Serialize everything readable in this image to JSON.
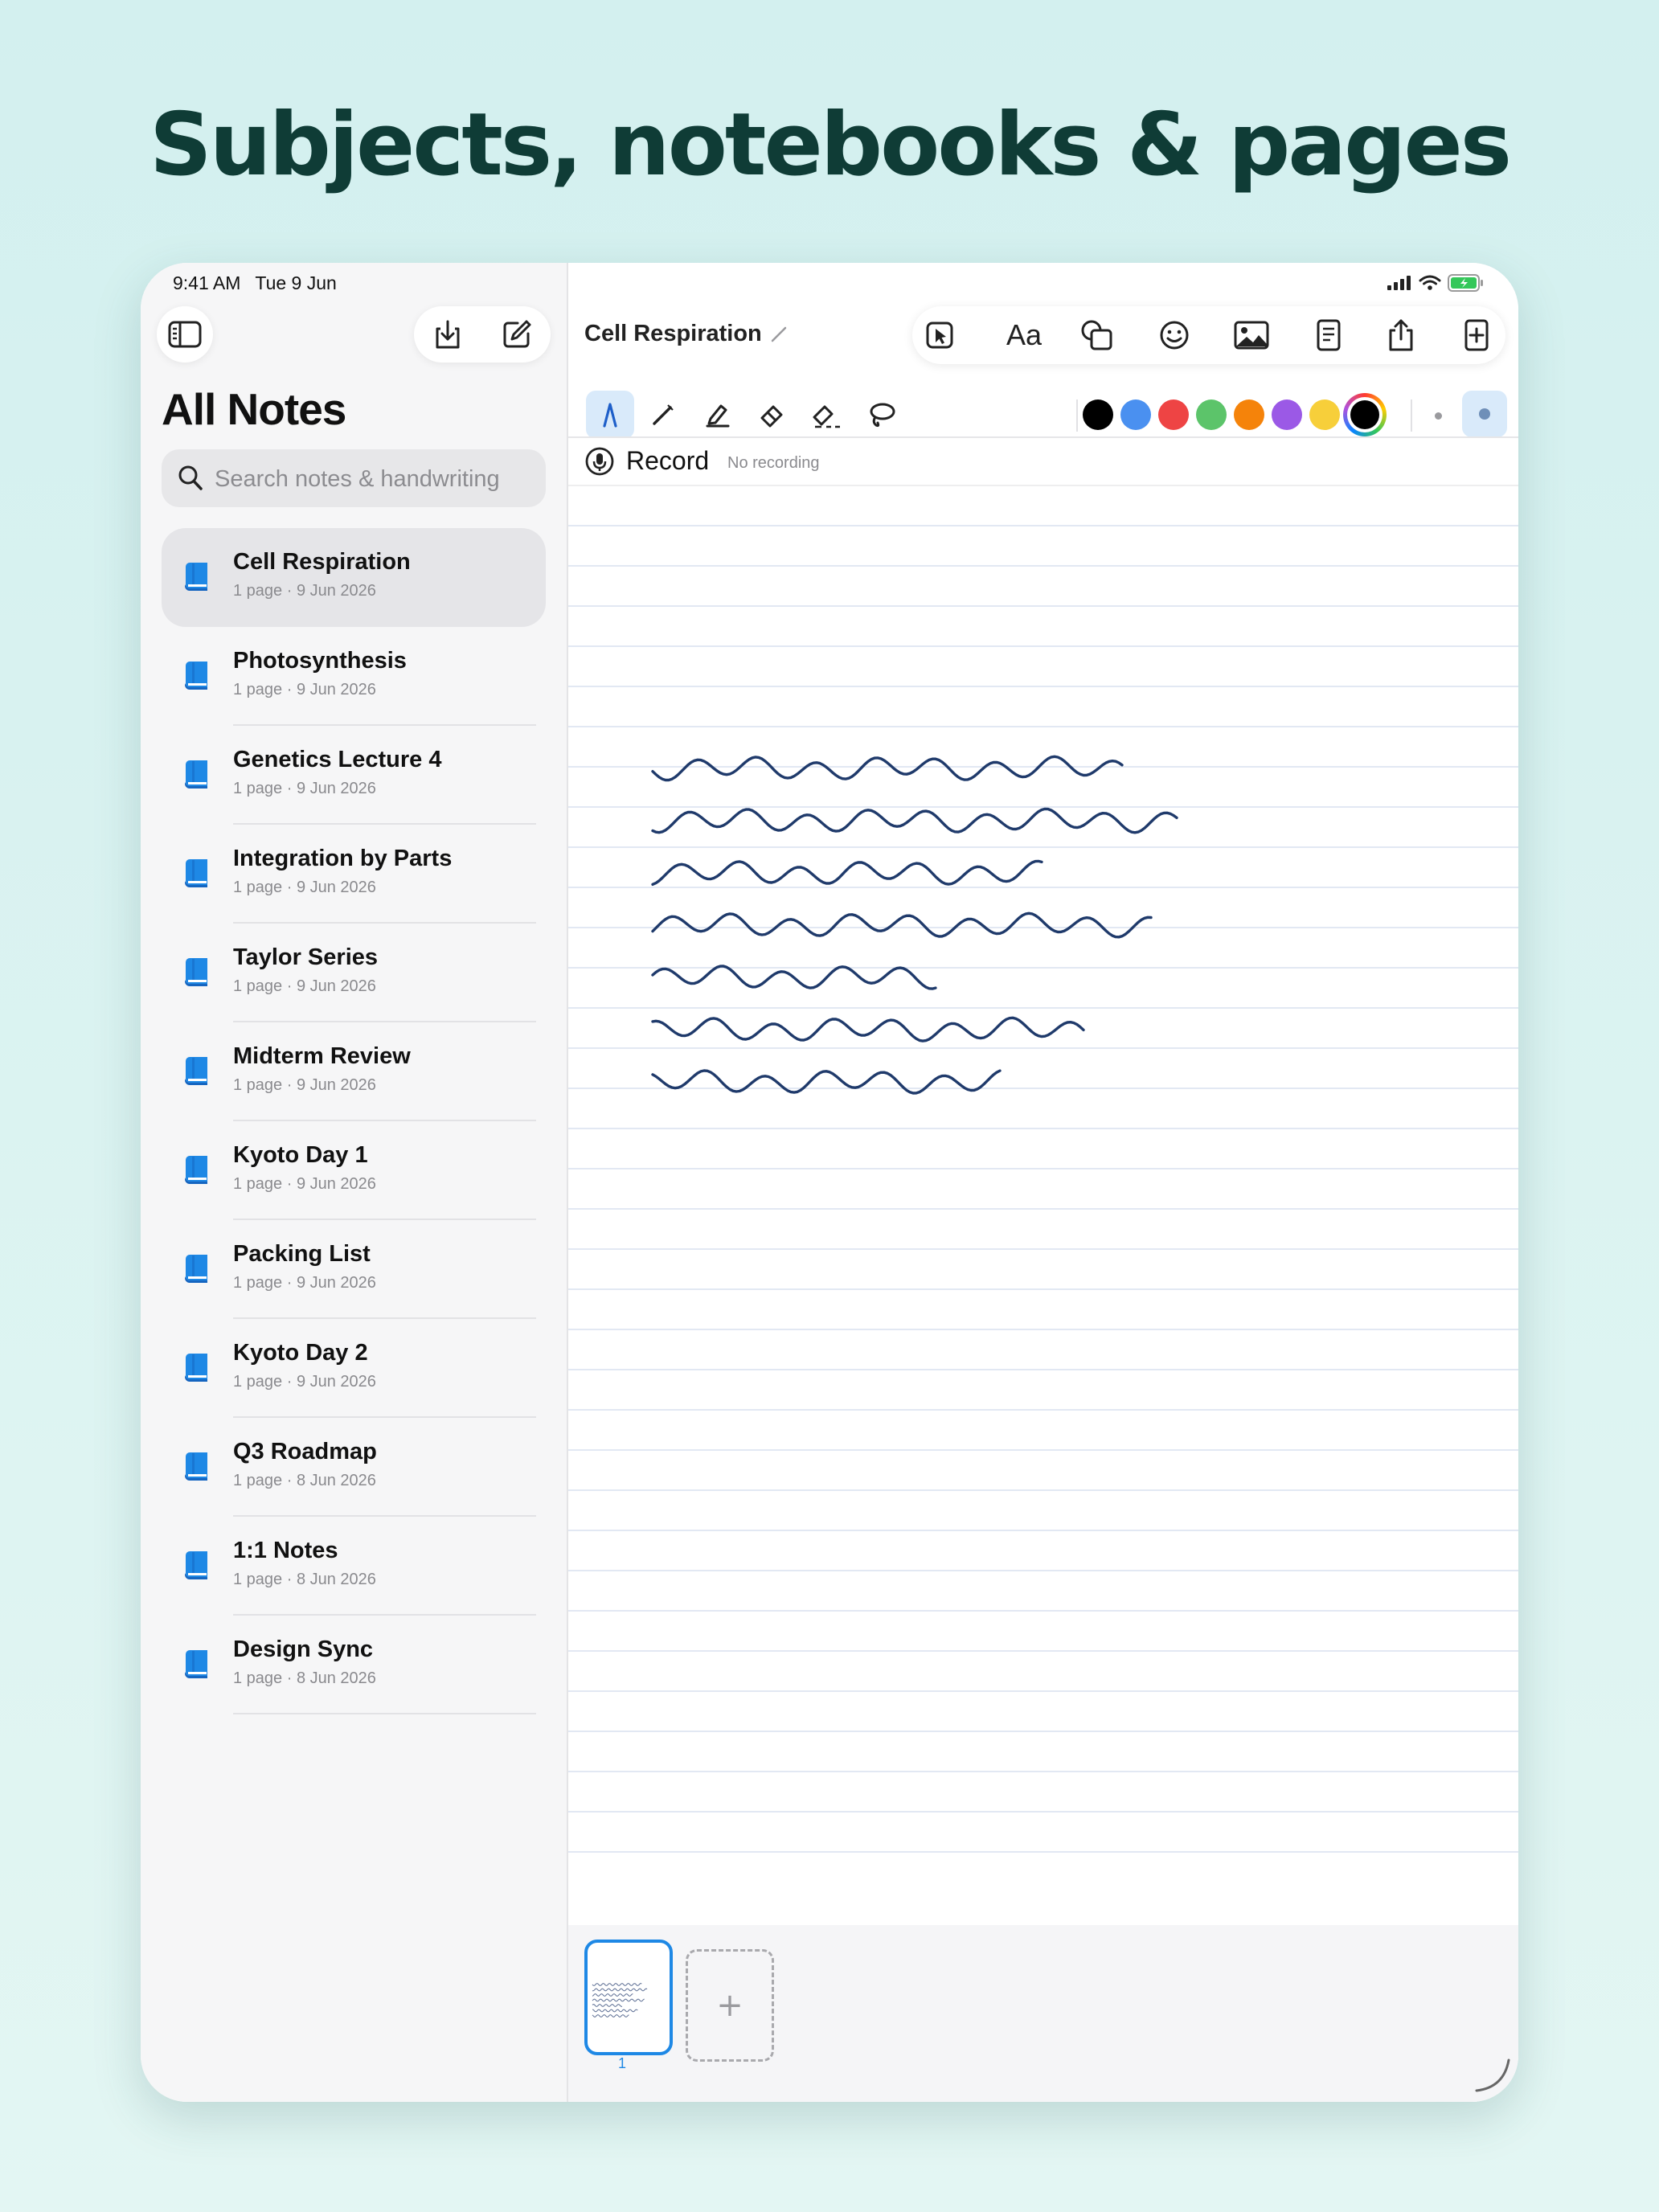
{
  "headline": "Subjects, notebooks & pages",
  "status": {
    "time": "9:41 AM",
    "date": "Tue 9 Jun"
  },
  "sidebar": {
    "title": "All Notes",
    "search_placeholder": "Search notes & handwriting",
    "notes": [
      {
        "title": "Cell Respiration",
        "meta": "1 page · 9 Jun 2026",
        "active": true
      },
      {
        "title": "Photosynthesis",
        "meta": "1 page · 9 Jun 2026"
      },
      {
        "title": "Genetics Lecture 4",
        "meta": "1 page · 9 Jun 2026"
      },
      {
        "title": "Integration by Parts",
        "meta": "1 page · 9 Jun 2026"
      },
      {
        "title": "Taylor Series",
        "meta": "1 page · 9 Jun 2026"
      },
      {
        "title": "Midterm Review",
        "meta": "1 page · 9 Jun 2026"
      },
      {
        "title": "Kyoto Day 1",
        "meta": "1 page · 9 Jun 2026"
      },
      {
        "title": "Packing List",
        "meta": "1 page · 9 Jun 2026"
      },
      {
        "title": "Kyoto Day 2",
        "meta": "1 page · 9 Jun 2026"
      },
      {
        "title": "Q3 Roadmap",
        "meta": "1 page · 8 Jun 2026"
      },
      {
        "title": "1:1 Notes",
        "meta": "1 page · 8 Jun 2026"
      },
      {
        "title": "Design Sync",
        "meta": "1 page · 8 Jun 2026"
      }
    ]
  },
  "editor": {
    "doc_title": "Cell Respiration",
    "text_tool_label": "Aa",
    "record_label": "Record",
    "record_status": "No recording",
    "page_number": "1",
    "add_page_symbol": "+"
  },
  "colors": {
    "accent": "#1e88e5",
    "ink": "#1f3a6b",
    "swatches": [
      "#000000",
      "#4a90f0",
      "#ee4444",
      "#5cc46a",
      "#f5830a",
      "#9b59e6",
      "#f7cf3a"
    ],
    "selected_swatch": "#000000"
  },
  "icons": {
    "sidebar_toggle": "sidebar-icon",
    "import": "import-icon",
    "compose": "compose-icon",
    "note": "notebook-icon",
    "select": "select-pointer-icon",
    "shapes": "shapes-icon",
    "emoji": "emoji-icon",
    "image": "image-icon",
    "page_template": "page-template-icon",
    "share": "share-icon",
    "add": "add-icon",
    "pen": "pen-icon",
    "pencil": "pencil-icon",
    "highlighter": "highlighter-icon",
    "eraser": "eraser-icon",
    "partial_eraser": "partial-eraser-icon",
    "lasso": "lasso-icon",
    "mic": "mic-icon"
  }
}
